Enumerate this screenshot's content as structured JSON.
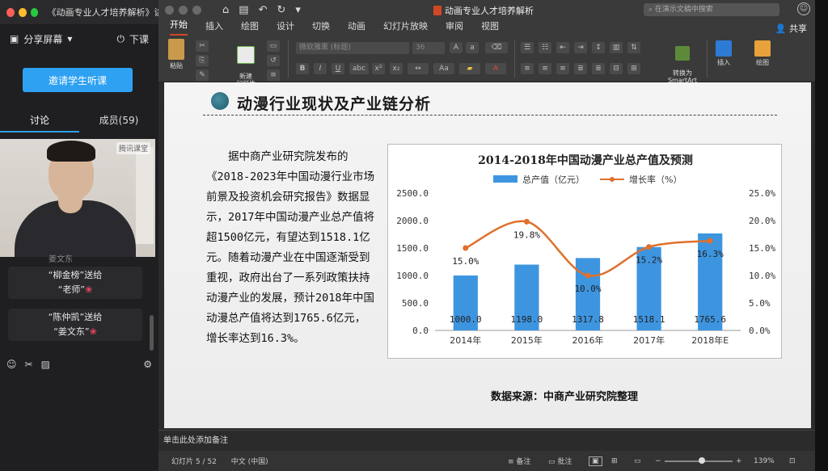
{
  "classroom": {
    "window_title": "《动画专业人才培养解析》讲座",
    "share_screen": "分享屏幕",
    "end_class": "下课",
    "invite_button": "邀请学生听课",
    "tab_discuss": "讨论",
    "tab_members": "成员(59)",
    "video_watermark": "腾讯课堂",
    "messages": [
      {
        "line1": "“柳金榜”送给",
        "line2": "“老师”"
      },
      {
        "line1": "“陈仲凯”送给",
        "line2": "“姜文东”"
      }
    ],
    "flower_glyph": "❀",
    "partial_text": "姜文东"
  },
  "ppt": {
    "doc_title": "动画专业人才培养解析",
    "search_placeholder": "在演示文稿中搜索",
    "menu": [
      "开始",
      "插入",
      "绘图",
      "设计",
      "切换",
      "动画",
      "幻灯片放映",
      "审阅",
      "视图"
    ],
    "share": "共享",
    "ribbon": {
      "paste": "粘贴",
      "new_slide": "新建\n幻灯片",
      "font_name": "微软雅黑 (标题)",
      "font_size": "36",
      "convert_smartart": "转换为\nSmartArt",
      "insert": "插入",
      "draw": "绘图"
    },
    "notes_prompt": "单击此处添加备注",
    "status": {
      "slide_info": "幻灯片 5 / 52",
      "language": "中文 (中国)",
      "notes": "备注",
      "comments": "批注",
      "zoom": "139%"
    },
    "accent": "#d24726"
  },
  "slide": {
    "title": "动漫行业现状及产业链分析",
    "body": "据中商产业研究院发布的《2018-2023年中国动漫行业市场前景及投资机会研究报告》数据显示，2017年中国动漫产业总产值将超1500亿元，有望达到1518.1亿元。随着动漫产业在中国逐渐受到重视，政府出台了一系列政策扶持动漫产业的发展，预计2018年中国动漫总产值将达到1765.6亿元，增长率达到16.3%。",
    "source": "数据来源：中商产业研究院整理"
  },
  "chart_data": {
    "type": "bar",
    "title": "2014-2018年中国动漫产业总产值及预测",
    "categories": [
      "2014年",
      "2015年",
      "2016年",
      "2017年",
      "2018年E"
    ],
    "series": [
      {
        "name": "总产值（亿元）",
        "type": "bar",
        "axis": "left",
        "values": [
          1000.0,
          1198.0,
          1317.8,
          1518.1,
          1765.6
        ],
        "labels": [
          "1000.0",
          "1198.0",
          "1317.8",
          "1518.1",
          "1765.6"
        ],
        "color": "#3d95e0"
      },
      {
        "name": "增长率（%）",
        "type": "line",
        "axis": "right",
        "values": [
          15.0,
          19.8,
          10.0,
          15.2,
          16.3
        ],
        "labels": [
          "15.0%",
          "19.8%",
          "10.0%",
          "15.2%",
          "16.3%"
        ],
        "color": "#e0702c"
      }
    ],
    "y_left": {
      "min": 0,
      "max": 2500,
      "ticks": [
        "0.0",
        "500.0",
        "1000.0",
        "1500.0",
        "2000.0",
        "2500.0"
      ]
    },
    "y_right": {
      "min": 0,
      "max": 25,
      "ticks": [
        "0.0%",
        "5.0%",
        "10.0%",
        "15.0%",
        "20.0%",
        "25.0%"
      ]
    },
    "legend": "top",
    "grid": false
  }
}
